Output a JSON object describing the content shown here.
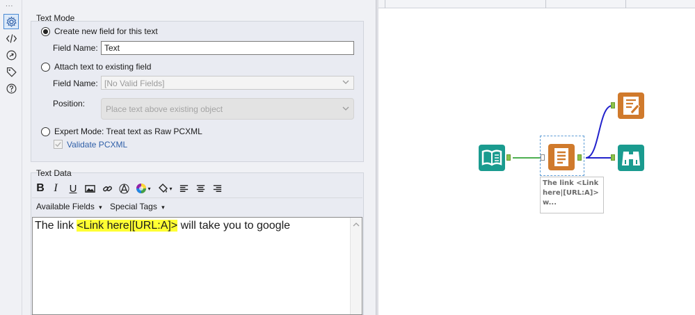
{
  "colors": {
    "accent": "#4a8ad4",
    "highlight": "#ffff33",
    "tool_teal": "#1a9b8f",
    "tool_orange": "#d07a2c",
    "connection_green": "#8bc34a",
    "wire_blue": "#2222cc"
  },
  "toolbar": {
    "dots": "...",
    "items": [
      {
        "icon": "gear-icon",
        "active": true
      },
      {
        "icon": "code-icon",
        "active": false
      },
      {
        "icon": "link-icon",
        "active": false
      },
      {
        "icon": "tag-icon",
        "active": false
      },
      {
        "icon": "help-icon",
        "active": false
      }
    ]
  },
  "text_mode": {
    "title": "Text Mode",
    "option_new": "Create new field for this text",
    "field_name_label": "Field Name:",
    "field_name_value": "Text",
    "option_attach": "Attach text to existing field",
    "attach_field_label": "Field Name:",
    "attach_field_value": "[No Valid Fields]",
    "position_label": "Position:",
    "position_value": "Place text above existing object",
    "option_expert": "Expert Mode: Treat text as Raw PCXML",
    "validate_label": "Validate PCXML",
    "selected": "option_new"
  },
  "text_data": {
    "title": "Text Data",
    "format_buttons": [
      "bold",
      "italic",
      "underline",
      "image",
      "link",
      "font",
      "color",
      "fill",
      "align-left",
      "align-center",
      "align-right"
    ],
    "bold_glyph": "B",
    "italic_glyph": "I",
    "underline_glyph": "U",
    "available_fields": "Available Fields",
    "special_tags": "Special Tags",
    "dropdown_arrow": "▾",
    "content_prefix": "The link ",
    "content_tag": "<Link here|[URL:A]>",
    "content_suffix": " will take you to google"
  },
  "canvas": {
    "annotation_line1": "The link <Link",
    "annotation_line2": "here|[URL:A]>",
    "annotation_line3": "w..."
  }
}
